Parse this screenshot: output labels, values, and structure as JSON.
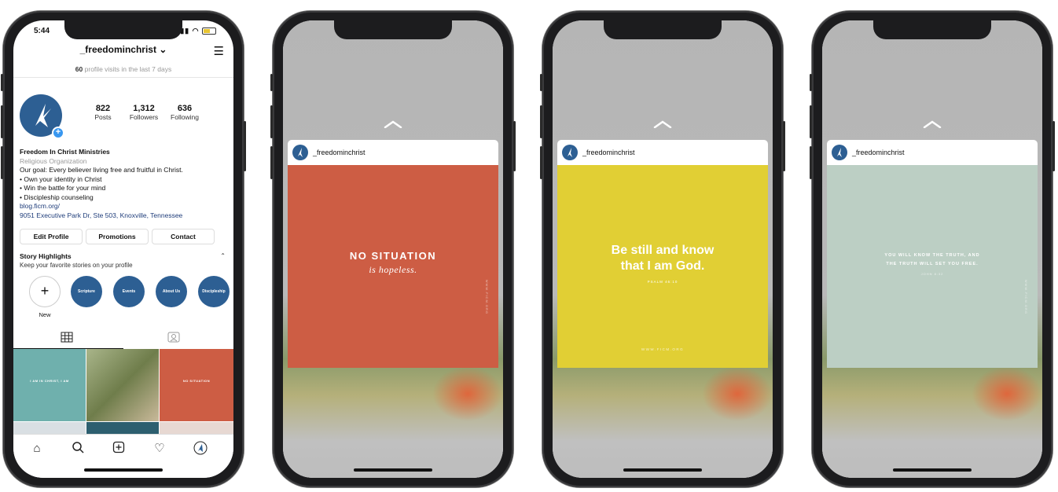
{
  "profile": {
    "status_time": "5:44",
    "username": "_freedominchrist",
    "header_chevron": "⌄",
    "visits_count": "60",
    "visits_text": "profile visits in the last 7 days",
    "posts": "822",
    "posts_label": "Posts",
    "followers": "1,312",
    "followers_label": "Followers",
    "following": "636",
    "following_label": "Following",
    "name": "Freedom In Christ Ministries",
    "category": "Religious Organization",
    "bio_lines": [
      "Our goal: Every believer living free and fruitful in Christ.",
      "• Own your identity in Christ",
      "• Win the battle for your mind",
      "• Discipleship counseling"
    ],
    "link": "blog.ficm.org/",
    "address": "9051 Executive Park Dr, Ste 503, Knoxville, Tennessee",
    "buttons": [
      "Edit Profile",
      "Promotions",
      "Contact"
    ],
    "highlights_title": "Story Highlights",
    "highlights_sub": "Keep your favorite stories on your profile",
    "highlights": [
      "Scripture",
      "Events",
      "About Us",
      "Discipleship"
    ],
    "new_label": "New",
    "grid_texts": [
      "I AM IN CHRIST, I AM",
      "NO SITUATION"
    ]
  },
  "stories": [
    {
      "username": "_freedominchrist",
      "bg": "#cd5d44",
      "line1": "NO SITUATION",
      "line2": "is hopeless.",
      "side": "WWW.FICM.ORG"
    },
    {
      "username": "_freedominchrist",
      "bg": "#e1cf34",
      "line1": "Be still and know",
      "line2": "that I am God.",
      "ref": "PSALM 46:10",
      "footer": "WWW.FICM.ORG"
    },
    {
      "username": "_freedominchrist",
      "bg": "#bccfc4",
      "line1": "YOU WILL KNOW THE TRUTH, AND",
      "line2": "THE TRUTH WILL SET YOU FREE.",
      "ref": "JOHN 8:32",
      "side": "WWW.FICM.ORG"
    }
  ],
  "colors": {
    "brand_blue": "#2d5f93",
    "link_blue": "#1f3d7a",
    "phone_frame": "#1c1c1e"
  }
}
